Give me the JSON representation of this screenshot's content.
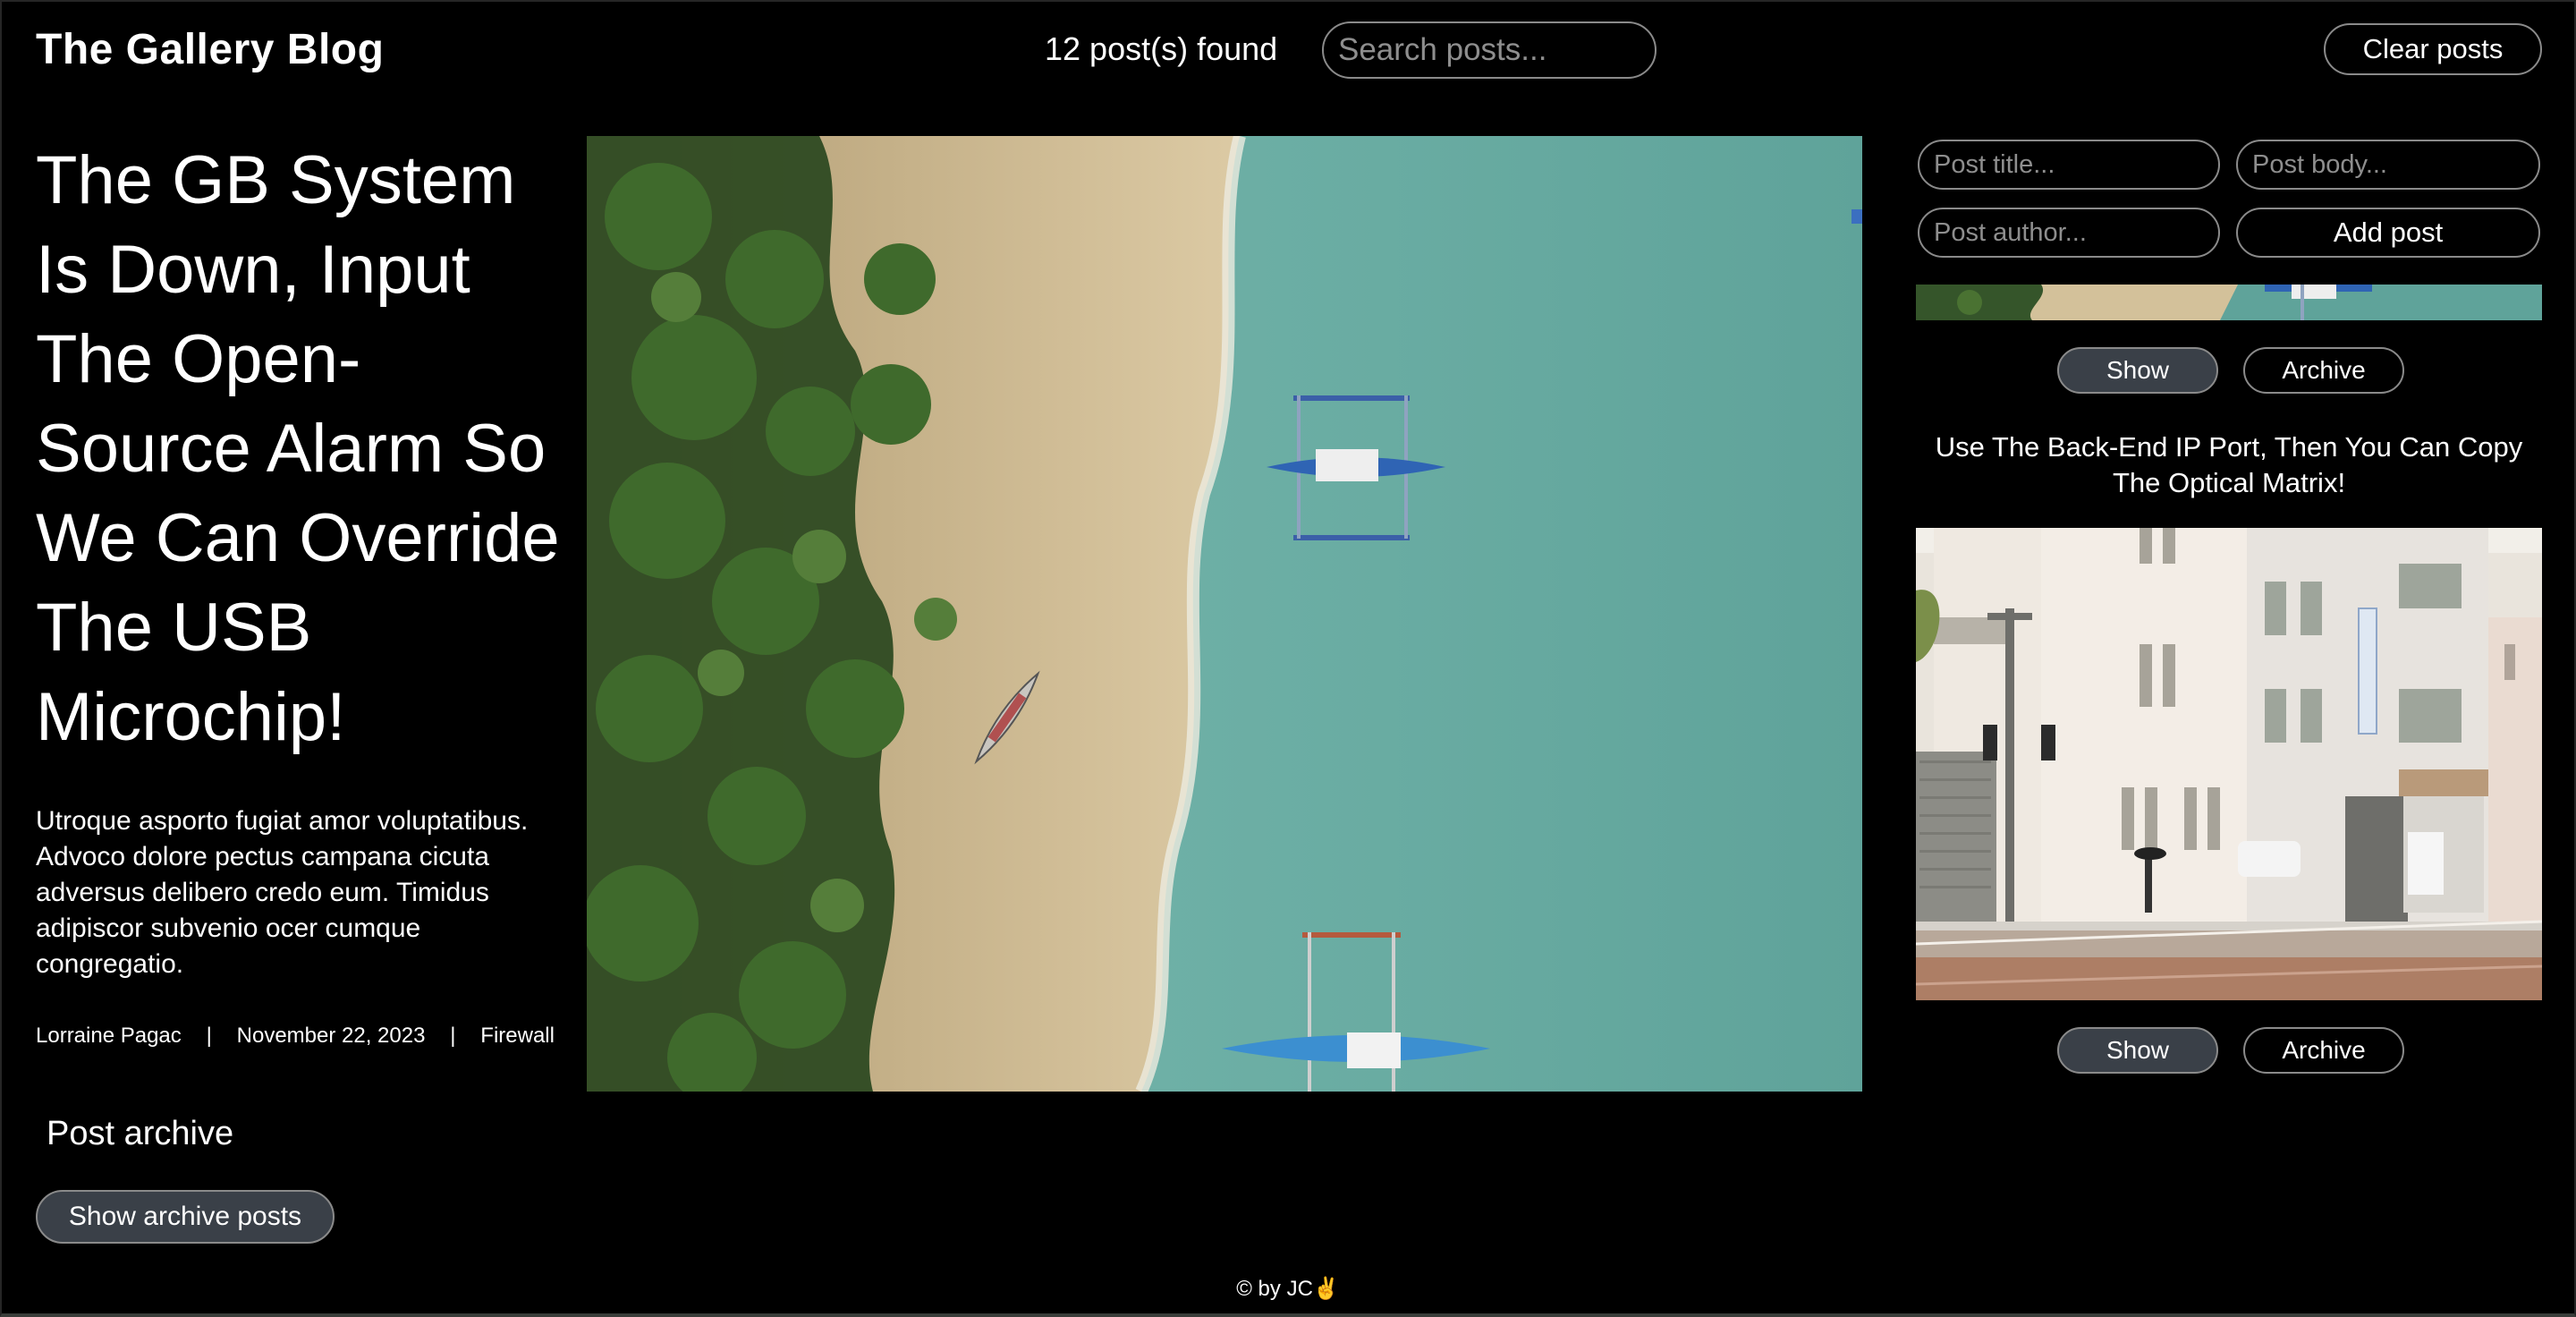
{
  "header": {
    "brand": "The Gallery Blog",
    "post_count": "12 post(s) found",
    "search_placeholder": "Search posts...",
    "clear_label": "Clear posts"
  },
  "featured": {
    "title": "The GB System Is Down, Input The Open-Source Alarm So We Can Override The USB Microchip!",
    "body": "Utroque asporto fugiat amor voluptatibus. Advoco dolore pectus campana cicuta adversus delibero credo eum. Timidus adipiscor subvenio ocer cumque congregatio.",
    "author": "Lorraine Pagac",
    "date": "November 22, 2023",
    "category": "Firewall",
    "separator": "|"
  },
  "archive": {
    "heading": "Post archive",
    "show_label": "Show archive posts"
  },
  "form": {
    "title_placeholder": "Post title...",
    "body_placeholder": "Post body...",
    "author_placeholder": "Post author...",
    "add_label": "Add post"
  },
  "posts": [
    {
      "show_label": "Show",
      "archive_label": "Archive"
    },
    {
      "title": "Use The Back-End IP Port, Then You Can Copy The Optical Matrix!",
      "show_label": "Show",
      "archive_label": "Archive"
    }
  ],
  "footer": {
    "text": "© by JC✌️"
  },
  "colors": {
    "background": "#000000",
    "text": "#ffffff",
    "border": "#8a8a8a",
    "button_dark": "#3a4048"
  }
}
